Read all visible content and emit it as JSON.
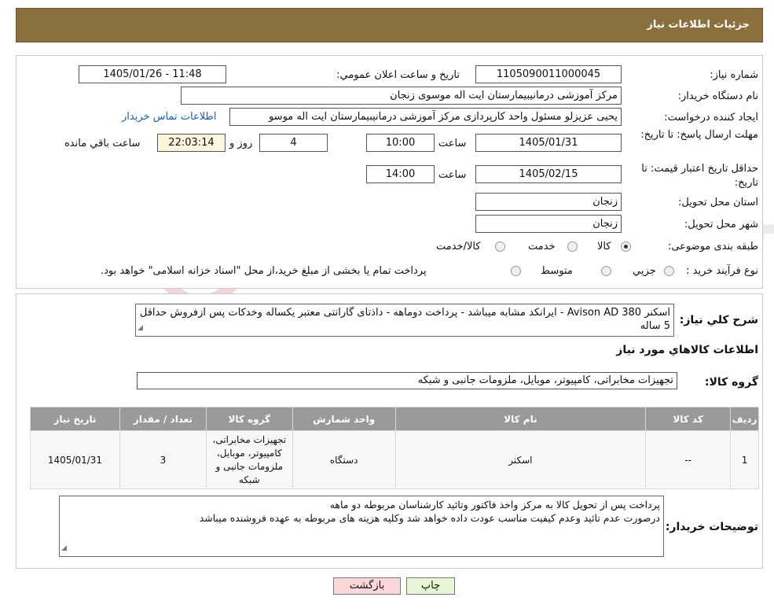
{
  "header": {
    "title": "جزئیات اطلاعات نیاز"
  },
  "form": {
    "need_number": {
      "label": "شماره نیاز:",
      "value": "1105090011000045"
    },
    "announce": {
      "label": "تاریخ و ساعت اعلان عمومي:",
      "value": "1405/01/26 - 11:48"
    },
    "buyer_org": {
      "label": "نام دستگاه خریدار:",
      "value": "مرکز آموزشی درمانیبیمارستان ایت اله موسوی زنجان"
    },
    "requester": {
      "label": "ایجاد کننده درخواست:",
      "value": "یحیی عزیزلو مسئول واحد کارپردازی مرکز آموزشی درمانیبیمارستان ایت اله موسو"
    },
    "contact_link": "اطلاعات تماس خریدار",
    "deadline": {
      "label": "مهلت ارسال پاسخ: تا تاریخ:",
      "date": "1405/01/31",
      "time_label": "ساعت",
      "time": "10:00",
      "days": "4",
      "days_label": "روز و",
      "remaining": "22:03:14",
      "remaining_label": "ساعت باقي مانده"
    },
    "validity": {
      "label": "حداقل تاریخ اعتبار قیمت: تا تاریخ:",
      "date": "1405/02/15",
      "time_label": "ساعت",
      "time": "14:00"
    },
    "province": {
      "label": "استان محل تحویل:",
      "value": "زنجان"
    },
    "city": {
      "label": "شهر محل تحویل:",
      "value": "زنجان"
    },
    "category": {
      "label": "طبقه بندی موضوعی:",
      "options": [
        "کالا",
        "خدمت",
        "کالا/خدمت"
      ],
      "selected": "کالا"
    },
    "process": {
      "label": "نوع فرآیند خرید :",
      "options": [
        "جزيي",
        "متوسط"
      ],
      "note": "پرداخت تمام یا بخشی از مبلغ خرید،از محل \"اسناد خزانه اسلامی\" خواهد بود."
    }
  },
  "description": {
    "label": "شرح کلي نياز:",
    "text": "اسکنر Avison AD 380  - ایرانکد مشابه میباشد - پرداخت دوماهه - داذتای گارانتی معتبر یکساله وخدکات پس ازفروش حداقل  5 ساله"
  },
  "goods": {
    "section_title": "اطلاعات کالاهاي مورد نياز",
    "group_label": "گروه کالا:",
    "group_value": "تجهیزات مخابراتی، کامپیوتر، موبایل، ملزومات جانبی و شبکه",
    "columns": [
      "رديف",
      "کد کالا",
      "نام کالا",
      "واحد شمارش",
      "گروه کالا",
      "تعداد / مقدار",
      "تاریخ نیاز"
    ],
    "rows": [
      {
        "row": "1",
        "code": "--",
        "name": "اسکنر",
        "unit": "دستگاه",
        "group": "تجهیزات مخابراتی، کامپیوتر، موبایل، ملزومات جانبی و شبکه",
        "qty": "3",
        "date": "1405/01/31"
      }
    ]
  },
  "buyer_notes": {
    "label": "توضیحات خریدار:",
    "line1": "پرداخت پس از تحویل کالا به مرکز واخذ فاکتور وتائید کارشناسان مربوطه دو ماهه",
    "line2": "درصورت عدم تائید وعدم کیفیت مناسب عودت داده خواهد شد وکلیه هزینه های مربوطه به عهده فروشنده میباشد"
  },
  "buttons": {
    "print": "چاپ",
    "back": "بازگشت"
  },
  "watermark": {
    "text": "AriaTender.neT"
  },
  "colors": {
    "header_bg": "#8b6f3e",
    "table_header_bg": "#9a9a9a",
    "link": "#1a5fb4",
    "back_button_bg": "#fbd7d7",
    "print_button_bg": "#e6f5d6"
  }
}
